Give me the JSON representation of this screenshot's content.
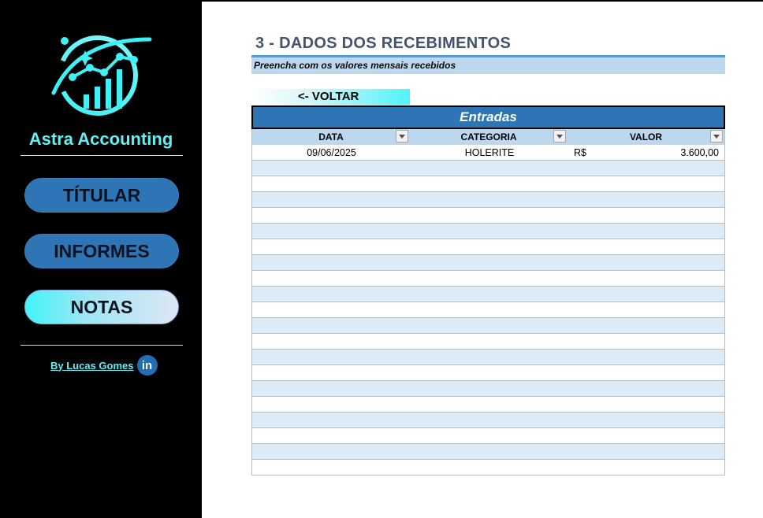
{
  "sidebar": {
    "brand": "Astra Accounting",
    "nav": [
      {
        "label": "TÍTULAR"
      },
      {
        "label": "INFORMES"
      },
      {
        "label": "NOTAS"
      }
    ],
    "author_link": "By Lucas Gomes",
    "author_icon": "linkedin-icon",
    "author_icon_text": "in"
  },
  "main": {
    "title": "3 - DADOS DOS RECEBIMENTOS",
    "subtitle": "Preencha com os valores mensais recebidos",
    "back_button": "<- VOLTAR",
    "table": {
      "title": "Entradas",
      "columns": [
        "DATA",
        "CATEGORIA",
        "VALOR"
      ],
      "rows": [
        {
          "date": "09/06/2025",
          "category": "HOLERITE",
          "currency": "R$",
          "value": "3.600,00"
        }
      ],
      "empty_row_count": 20
    }
  },
  "colors": {
    "sidebar_bg": "#000000",
    "accent_cyan": "#5ef1f5",
    "nav_blue": "#2e75b6",
    "header_blue": "#2e75b6",
    "band_light": "#ddebf7",
    "title_gray": "#44546a"
  }
}
